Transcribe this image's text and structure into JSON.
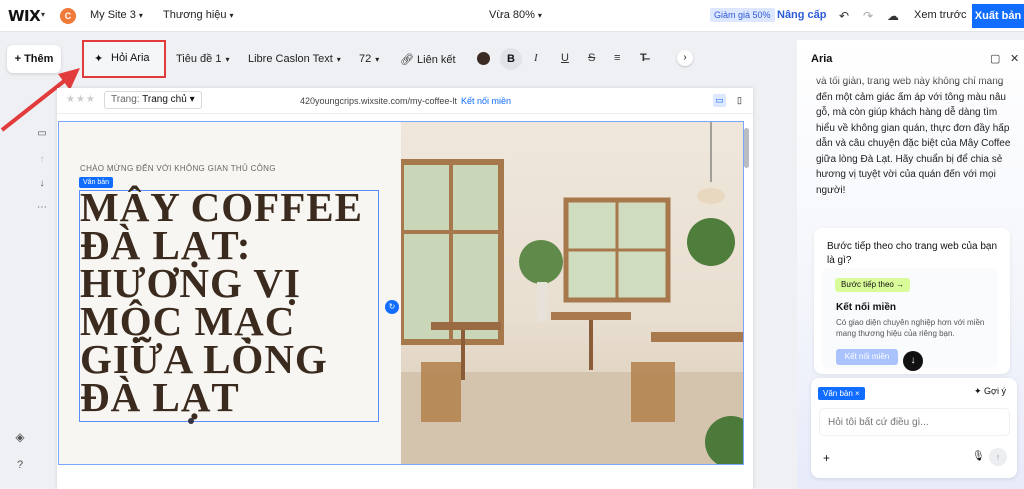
{
  "topbar": {
    "logo": "WIX",
    "site_initial": "C",
    "site_name": "My Site 3",
    "brand": "Thương hiệu",
    "zoom": "Vừa 80%",
    "discount": "Giảm giá 50%",
    "upgrade": "Nâng cấp",
    "preview": "Xem trước",
    "publish": "Xuất bản"
  },
  "toolbar": {
    "add": "Thêm",
    "ask_aria": "Hỏi Aria",
    "heading": "Tiêu đề 1",
    "font": "Libre Caslon Text",
    "size": "72",
    "link": "Liên kết",
    "bold": "B",
    "italic": "I",
    "underline": "U",
    "strike": "S",
    "text_color": "#3a2a22"
  },
  "canvas": {
    "page_label": "Trang:",
    "page_value": "Trang chủ",
    "url": "420youngcrips.wixsite.com/my-coffee-lt",
    "connect_domain": "Kết nối miền",
    "welcome": "CHÀO MỪNG ĐẾN VỚI KHÔNG GIAN THỦ CÔNG",
    "tag": "Văn bản",
    "headline": "MÂY COFFEE ĐÀ LẠT: HƯƠNG VỊ MỘC MẠC GIỮA LÒNG ĐÀ LẠT"
  },
  "aria": {
    "title": "Aria",
    "message": "và tối giản, trang web này không chỉ mang đến một cảm giác ấm áp với tông màu nâu gỗ, mà còn giúp khách hàng dễ dàng tìm hiểu về không gian quán, thực đơn đầy hấp dẫn và câu chuyện đặc biệt của Mây Coffee giữa lòng Đà Lạt. Hãy chuẩn bị để chia sẻ hương vị tuyệt vời của quán đến với mọi người!",
    "next_question": "Bước tiếp theo cho trang web của bạn là gì?",
    "next_pill": "Bước tiếp theo",
    "domain_title": "Kết nối miền",
    "domain_desc": "Có giao diện chuyên nghiệp hơn với miền mang thương hiệu của riêng bạn.",
    "domain_button": "Kết nối miền",
    "chip": "Văn bản",
    "suggest": "Gợi ý",
    "input_placeholder": "Hỏi tôi bất cứ điều gì..."
  }
}
